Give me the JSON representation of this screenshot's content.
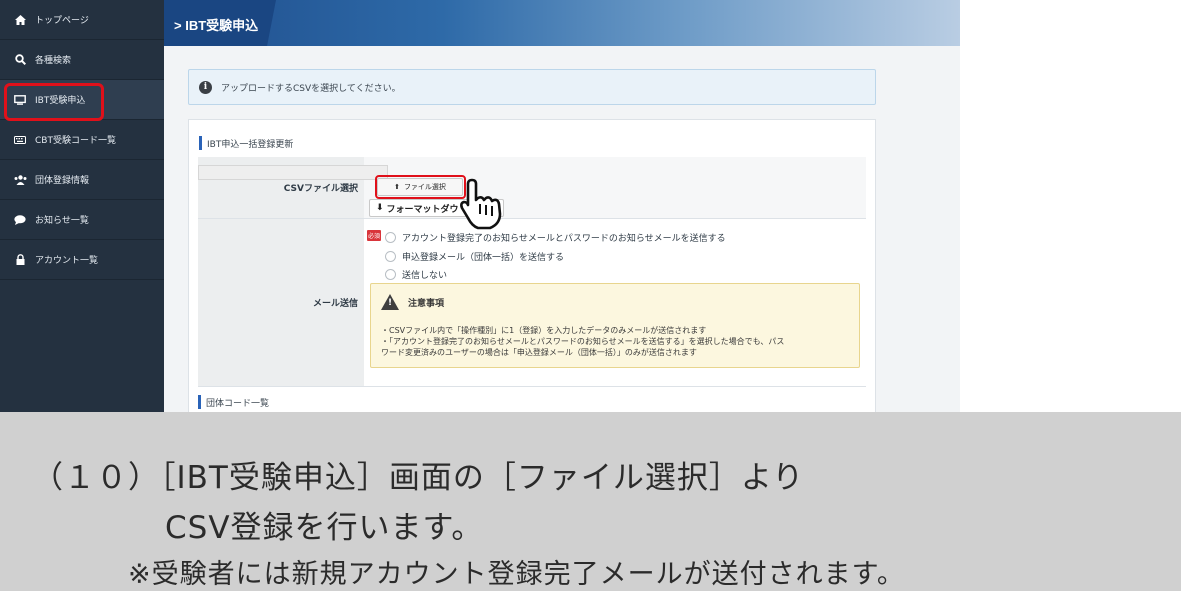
{
  "sidebar": {
    "items": [
      {
        "icon": "home-icon",
        "label": "トップページ"
      },
      {
        "icon": "search-icon",
        "label": "各種検索"
      },
      {
        "icon": "monitor-icon",
        "label": "IBT受験申込"
      },
      {
        "icon": "keyboard-icon",
        "label": "CBT受験コード一覧"
      },
      {
        "icon": "group-icon",
        "label": "団体登録情報"
      },
      {
        "icon": "comment-icon",
        "label": "お知らせ一覧"
      },
      {
        "icon": "lock-icon",
        "label": "アカウント一覧"
      }
    ]
  },
  "header": {
    "title": "IBT受験申込"
  },
  "info": {
    "text": "アップロードするCSVを選択してください。"
  },
  "section": {
    "title": "IBT申込一括登録更新",
    "next_title": "団体コード一覧"
  },
  "form": {
    "required_badge": "必須",
    "csv": {
      "label": "CSVファイル選択",
      "file_button": "ファイル選択",
      "format_button": "フォーマットダウ"
    },
    "mail": {
      "label": "メール送信",
      "options": [
        "アカウント登録完了のお知らせメールとパスワードのお知らせメールを送信する",
        "申込登録メール（団体一括）を送信する",
        "送信しない"
      ]
    },
    "notice": {
      "title": "注意事項",
      "line1": "・CSVファイル内で「操作種別」に1（登録）を入力したデータのみメールが送信されます",
      "line2": "・「アカウント登録完了のお知らせメールとパスワードのお知らせメールを送信する」を選択した場合でも、パス",
      "line3": "ワード変更済みのユーザーの場合は「申込登録メール（団体一括）」のみが送信されます"
    }
  },
  "caption": {
    "line1": "（１０）［IBT受験申込］画面の［ファイル選択］より",
    "line2": "CSV登録を行います。",
    "line3": "※受験者には新規アカウント登録完了メールが送付されます。"
  },
  "colors": {
    "sidebar": "#243140",
    "header": "#1f4e8d",
    "highlight": "#e0101a",
    "caption_bg": "#d0d0d0"
  }
}
